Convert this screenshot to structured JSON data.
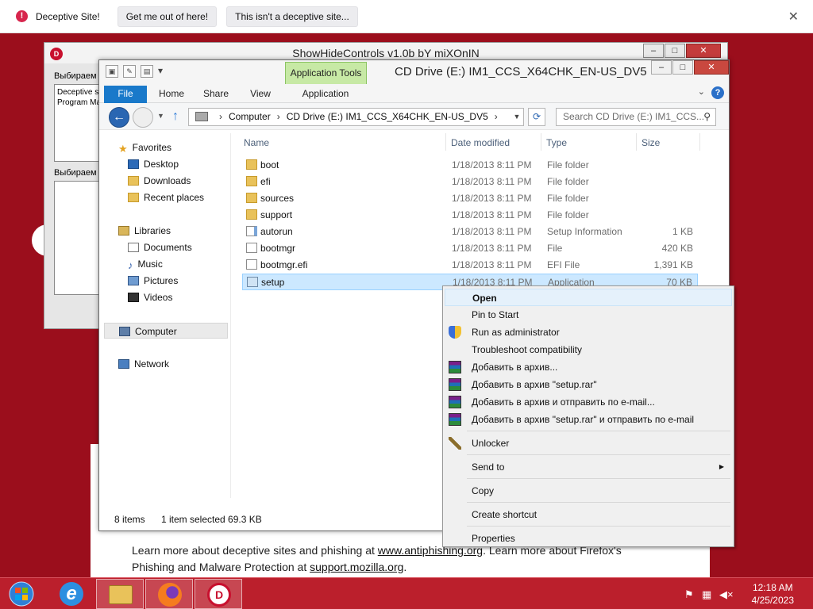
{
  "browser_warning": {
    "title": "Deceptive Site!",
    "get_out_label": "Get me out of here!",
    "not_deceptive_label": "This isn't a deceptive site...",
    "close_label": "✕"
  },
  "page": {
    "learn_line1_pre": "Learn more about deceptive sites and phishing at ",
    "learn_link1": "www.antiphishing.org",
    "learn_line1_post": ". Learn more about Firefox's",
    "learn_line2_pre": "Phishing and Malware Protection at ",
    "learn_link2": "support.mozilla.org",
    "learn_line2_post": "."
  },
  "shc_window": {
    "title": "ShowHideControls v1.0b bY miXOnIN",
    "label1": "Выбираем п",
    "list1": [
      "Deceptive s",
      "Program Ma"
    ],
    "label2": "Выбираем т"
  },
  "explorer": {
    "title": "CD Drive (E:) IM1_CCS_X64CHK_EN-US_DV5",
    "app_tools_label": "Application Tools",
    "ribbon_tabs": [
      "File",
      "Home",
      "Share",
      "View",
      "Application"
    ],
    "address": {
      "parts": [
        "Computer",
        "CD Drive (E:) IM1_CCS_X64CHK_EN-US_DV5"
      ],
      "search_placeholder": "Search CD Drive (E:) IM1_CCS..."
    },
    "nav": {
      "favorites": "Favorites",
      "desktop": "Desktop",
      "downloads": "Downloads",
      "recent": "Recent places",
      "libraries": "Libraries",
      "documents": "Documents",
      "music": "Music",
      "pictures": "Pictures",
      "videos": "Videos",
      "computer": "Computer",
      "network": "Network"
    },
    "columns": {
      "name": "Name",
      "date": "Date modified",
      "type": "Type",
      "size": "Size"
    },
    "files": [
      {
        "name": "boot",
        "date": "1/18/2013 8:11 PM",
        "type": "File folder",
        "size": "",
        "icon": "folder"
      },
      {
        "name": "efi",
        "date": "1/18/2013 8:11 PM",
        "type": "File folder",
        "size": "",
        "icon": "folder"
      },
      {
        "name": "sources",
        "date": "1/18/2013 8:11 PM",
        "type": "File folder",
        "size": "",
        "icon": "folder"
      },
      {
        "name": "support",
        "date": "1/18/2013 8:11 PM",
        "type": "File folder",
        "size": "",
        "icon": "folder"
      },
      {
        "name": "autorun",
        "date": "1/18/2013 8:11 PM",
        "type": "Setup Information",
        "size": "1 KB",
        "icon": "setupinf"
      },
      {
        "name": "bootmgr",
        "date": "1/18/2013 8:11 PM",
        "type": "File",
        "size": "420 KB",
        "icon": "file"
      },
      {
        "name": "bootmgr.efi",
        "date": "1/18/2013 8:11 PM",
        "type": "EFI File",
        "size": "1,391 KB",
        "icon": "file"
      },
      {
        "name": "setup",
        "date": "1/18/2013 8:11 PM",
        "type": "Application",
        "size": "70 KB",
        "icon": "app"
      }
    ],
    "status": {
      "count": "8 items",
      "selected": "1 item selected  69.3 KB"
    }
  },
  "context_menu": {
    "items": [
      {
        "label": "Open",
        "icon": ""
      },
      {
        "label": "Pin to Start",
        "icon": ""
      },
      {
        "label": "Run as administrator",
        "icon": "shield-icon"
      },
      {
        "label": "Troubleshoot compatibility",
        "icon": ""
      },
      {
        "label": "Добавить в архив...",
        "icon": "winrar-icon"
      },
      {
        "label": "Добавить в архив \"setup.rar\"",
        "icon": "winrar-icon"
      },
      {
        "label": "Добавить в архив и отправить по e-mail...",
        "icon": "winrar-icon"
      },
      {
        "label": "Добавить в архив \"setup.rar\" и отправить по e-mail",
        "icon": "winrar-icon"
      },
      {
        "label": "Unlocker",
        "icon": "unlocker-wand-icon"
      },
      {
        "label": "Send to",
        "icon": ""
      },
      {
        "label": "Copy",
        "icon": ""
      },
      {
        "label": "Create shortcut",
        "icon": ""
      },
      {
        "label": "Properties",
        "icon": ""
      }
    ]
  },
  "taskbar": {
    "time": "12:18 AM",
    "date": "4/25/2023"
  },
  "colors": {
    "page_bg": "#9b0e1c",
    "taskbar": "#bb1f2c",
    "selection": "#cce8ff",
    "file_tab": "#1979ca",
    "app_tools": "#c7e9a5"
  }
}
